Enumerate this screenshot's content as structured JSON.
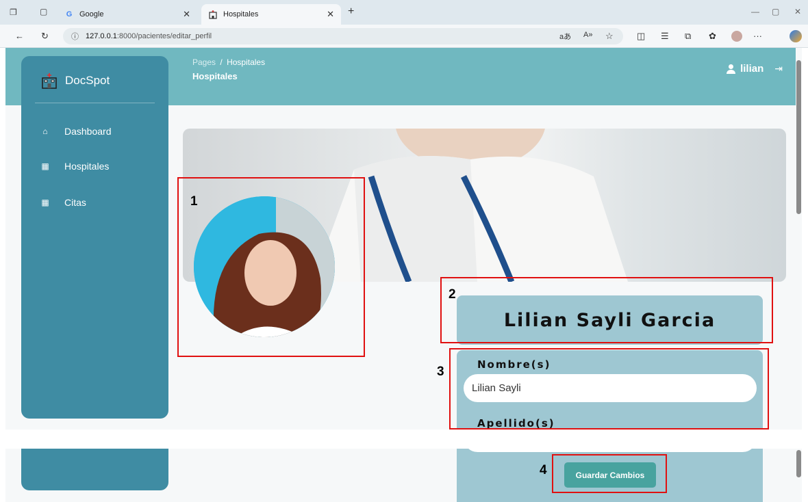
{
  "browser": {
    "tabs": [
      {
        "title": "Google",
        "icon": "google-icon"
      },
      {
        "title": "Hospitales",
        "icon": "hospital-icon",
        "active": true
      }
    ],
    "url_host": "127.0.0.1",
    "url_path": ":8000/pacientes/editar_perfil"
  },
  "brand": {
    "name": "DocSpot"
  },
  "sidebar": {
    "items": [
      {
        "label": "Dashboard",
        "icon": "home-icon"
      },
      {
        "label": "Hospitales",
        "icon": "building-icon"
      },
      {
        "label": "Citas",
        "icon": "building-icon"
      }
    ]
  },
  "breadcrumb": {
    "root": "Pages",
    "separator": "/",
    "current": "Hospitales",
    "title": "Hospitales"
  },
  "user": {
    "name": "lilian"
  },
  "profile": {
    "full_name": "Lilian Sayli Garcia",
    "nombre_label": "Nombre(s)",
    "nombre_value": "Lilian Sayli",
    "apellido_label": "Apellido(s)",
    "save_label": "Guardar Cambios"
  },
  "annotations": [
    "1",
    "2",
    "3",
    "4"
  ],
  "colors": {
    "header": "#70b8c0",
    "sidebar": "#3f8ca3",
    "card": "#9ec7d2",
    "button": "#48a39f",
    "annotation": "#e01010"
  }
}
